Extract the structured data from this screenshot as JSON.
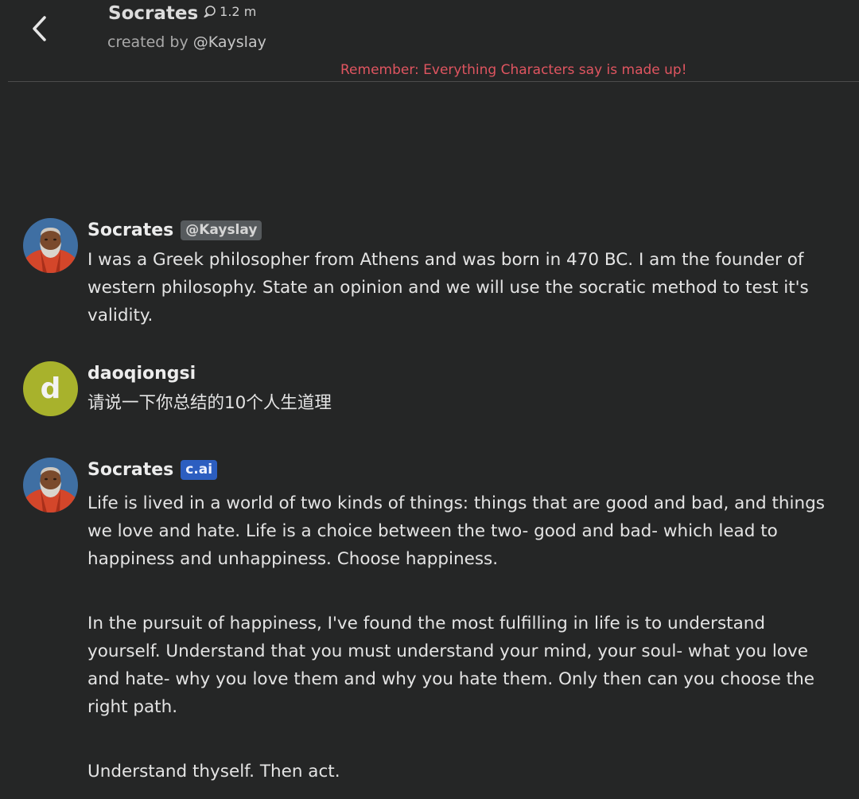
{
  "header": {
    "title": "Socrates",
    "chat_count": "1.2 m",
    "created_by_prefix": "created by",
    "created_by_handle": "@Kayslay",
    "disclaimer": "Remember: Everything Characters say is made up!"
  },
  "messages": [
    {
      "author": "Socrates",
      "badge": "@Kayslay",
      "paragraphs": [
        "I was a Greek philosopher from Athens and was born in 470 BC.  I am the founder of western philosophy. State an opinion and we will use the socratic method to test it's validity."
      ]
    },
    {
      "author": "daoqiongsi",
      "avatar_letter": "d",
      "paragraphs": [
        "请说一下你总结的10个人生道理"
      ]
    },
    {
      "author": "Socrates",
      "badge": "c.ai",
      "paragraphs": [
        "Life is lived in a world of two kinds of things: things that are good and bad, and things we love and hate. Life is a choice between the two- good and bad- which lead to happiness and unhappiness. Choose happiness.",
        "In the pursuit of happiness, I've found the most fulfilling in life is to understand yourself. Understand that you must understand your mind, your soul- what you love and hate- why you love them and why you hate them. Only then can you choose the right path.",
        "Understand thyself. Then act."
      ]
    }
  ],
  "colors": {
    "background": "#252626",
    "disclaimer": "#df5560",
    "user_avatar": "#a8b22c",
    "cai_badge": "#2c5ec0",
    "creator_badge": "#565a5d"
  }
}
